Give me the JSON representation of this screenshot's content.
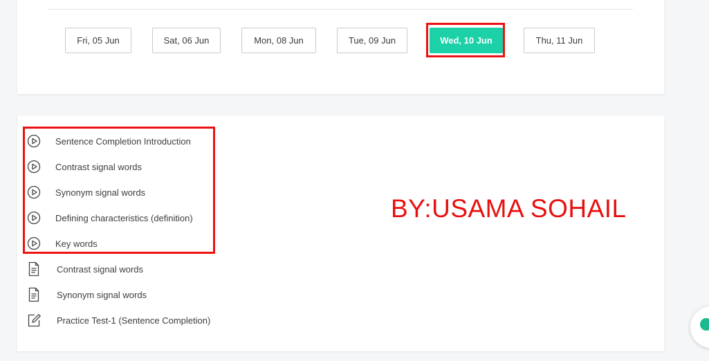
{
  "dates": {
    "items": [
      {
        "label": "Fri, 05 Jun",
        "active": false
      },
      {
        "label": "Sat, 06 Jun",
        "active": false
      },
      {
        "label": "Mon, 08 Jun",
        "active": false
      },
      {
        "label": "Tue, 09 Jun",
        "active": false
      },
      {
        "label": "Wed, 10 Jun",
        "active": true
      },
      {
        "label": "Thu, 11 Jun",
        "active": false
      }
    ],
    "accent_color": "#1cd1a8"
  },
  "lessons": {
    "items": [
      {
        "label": "Sentence Completion Introduction",
        "icon": "play-circle-icon"
      },
      {
        "label": "Contrast signal words",
        "icon": "play-circle-icon"
      },
      {
        "label": "Synonym signal words",
        "icon": "play-circle-icon"
      },
      {
        "label": "Defining characteristics (definition)",
        "icon": "play-circle-icon"
      },
      {
        "label": "Key words",
        "icon": "play-circle-icon"
      },
      {
        "label": "Contrast signal words",
        "icon": "document-icon"
      },
      {
        "label": "Synonym signal words",
        "icon": "document-icon"
      },
      {
        "label": "Practice Test-1 (Sentence Completion)",
        "icon": "edit-icon"
      }
    ]
  },
  "watermark": {
    "text": "BY:USAMA SOHAIL",
    "color": "#e81010"
  },
  "highlight_color": "#ee1111",
  "chat": {
    "icon": "chat-icon"
  }
}
